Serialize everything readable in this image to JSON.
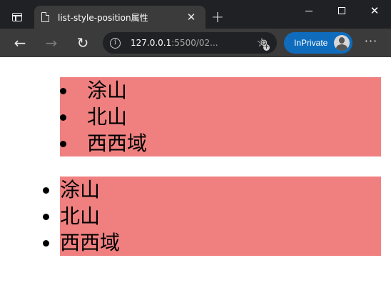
{
  "browser": {
    "tab": {
      "title": "list-style-position属性"
    },
    "window_controls": [
      "minimize",
      "maximize",
      "close"
    ],
    "address": {
      "host": "127.0.0.1",
      "rest": ":5500/02..."
    },
    "profile": {
      "label": "InPrivate"
    }
  },
  "page": {
    "list_inside": {
      "items": [
        "涂山",
        "北山",
        "西西域"
      ]
    },
    "list_outside": {
      "items": [
        "涂山",
        "北山",
        "西西域"
      ]
    },
    "colors": {
      "list_background": "#f08080"
    }
  },
  "icons": {
    "tab_actions": "tab-actions-icon",
    "page": "page-icon",
    "close_tab": "close-icon",
    "new_tab": "plus-icon",
    "back": "back-arrow-icon",
    "forward": "forward-arrow-icon",
    "refresh": "refresh-icon",
    "site_info": "info-icon",
    "zoom": "zoom-icon",
    "favorites": "add-favorite-icon",
    "more": "more-icon"
  }
}
